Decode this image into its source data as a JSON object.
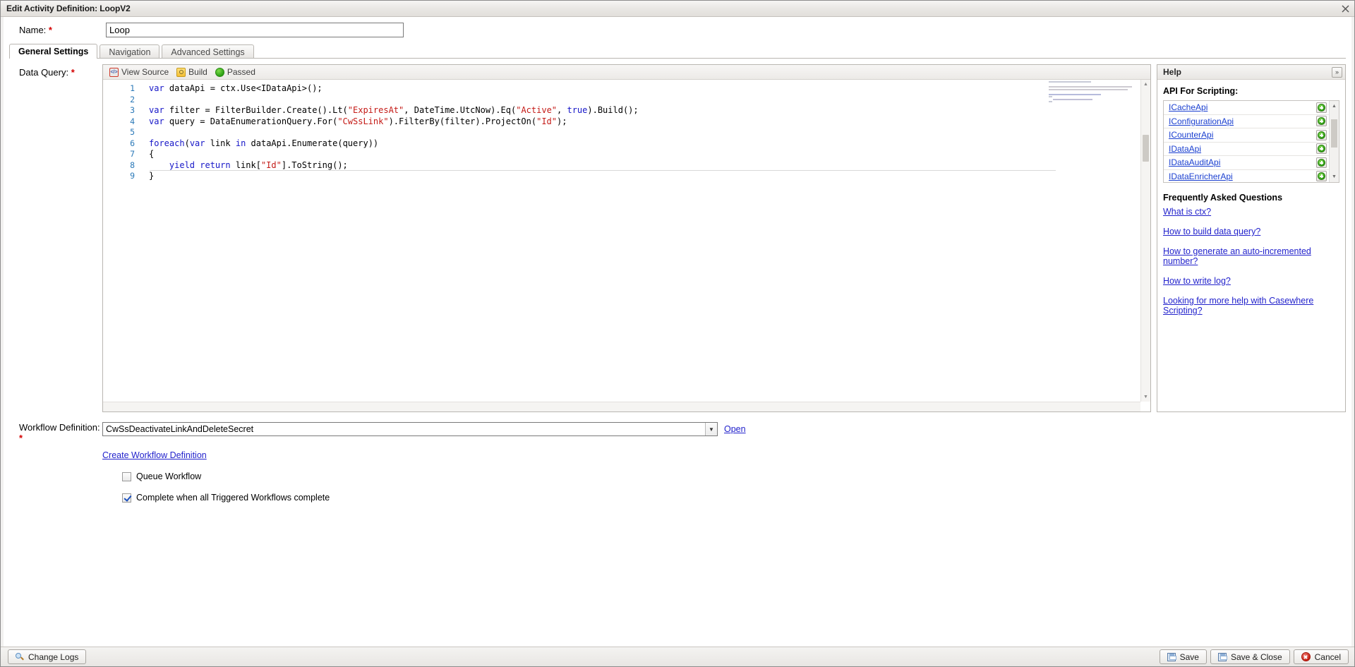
{
  "window": {
    "title": "Edit Activity Definition: LoopV2",
    "close_icon": "close-icon"
  },
  "form": {
    "name_label": "Name:",
    "name_value": "Loop",
    "required_marker": "*",
    "data_query_label": "Data Query:",
    "workflow_label": "Workflow Definition:"
  },
  "tabs": [
    {
      "label": "General Settings",
      "active": true
    },
    {
      "label": "Navigation",
      "active": false
    },
    {
      "label": "Advanced Settings",
      "active": false
    }
  ],
  "editor": {
    "toolbar": {
      "view_source": "View Source",
      "build": "Build",
      "status": "Passed",
      "status_color": "#2da015"
    },
    "lines": [
      {
        "n": "1",
        "segments": [
          {
            "t": "var ",
            "c": "kw"
          },
          {
            "t": "dataApi = ctx.Use<IDataApi>();",
            "c": "code-txt"
          }
        ]
      },
      {
        "n": "2",
        "segments": []
      },
      {
        "n": "3",
        "segments": [
          {
            "t": "var ",
            "c": "kw"
          },
          {
            "t": "filter = FilterBuilder.Create().Lt(",
            "c": "code-txt"
          },
          {
            "t": "\"ExpiresAt\"",
            "c": "str"
          },
          {
            "t": ", DateTime.UtcNow).Eq(",
            "c": "code-txt"
          },
          {
            "t": "\"Active\"",
            "c": "str"
          },
          {
            "t": ", ",
            "c": "code-txt"
          },
          {
            "t": "true",
            "c": "kw"
          },
          {
            "t": ").Build();",
            "c": "code-txt"
          }
        ]
      },
      {
        "n": "4",
        "segments": [
          {
            "t": "var ",
            "c": "kw"
          },
          {
            "t": "query = DataEnumerationQuery.For(",
            "c": "code-txt"
          },
          {
            "t": "\"CwSsLink\"",
            "c": "str"
          },
          {
            "t": ").FilterBy(filter).ProjectOn(",
            "c": "code-txt"
          },
          {
            "t": "\"Id\"",
            "c": "str"
          },
          {
            "t": ");",
            "c": "code-txt"
          }
        ]
      },
      {
        "n": "5",
        "segments": []
      },
      {
        "n": "6",
        "segments": [
          {
            "t": "foreach",
            "c": "cf"
          },
          {
            "t": "(",
            "c": "code-txt"
          },
          {
            "t": "var ",
            "c": "kw"
          },
          {
            "t": "link ",
            "c": "code-txt"
          },
          {
            "t": "in ",
            "c": "kw"
          },
          {
            "t": "dataApi.Enumerate(query))",
            "c": "code-txt"
          }
        ]
      },
      {
        "n": "7",
        "segments": [
          {
            "t": "{",
            "c": "code-txt"
          }
        ]
      },
      {
        "n": "8",
        "segments": [
          {
            "t": "    ",
            "c": "code-txt"
          },
          {
            "t": "yield return ",
            "c": "kw"
          },
          {
            "t": "link[",
            "c": "code-txt"
          },
          {
            "t": "\"Id\"",
            "c": "str"
          },
          {
            "t": "].ToString();",
            "c": "code-txt"
          }
        ]
      },
      {
        "n": "9",
        "segments": [
          {
            "t": "}",
            "c": "code-txt"
          }
        ]
      }
    ]
  },
  "help": {
    "header": "Help",
    "collapse_icon": "chevron-double-right-icon",
    "api_heading": "API For Scripting:",
    "api_items": [
      "ICacheApi",
      "IConfigurationApi",
      "ICounterApi",
      "IDataApi",
      "IDataAuditApi",
      "IDataEnricherApi"
    ],
    "faq_heading": "Frequently Asked Questions",
    "faq_links": [
      "What is ctx?",
      "How to build data query?",
      "How to generate an auto-incremented number?",
      "How to write log?",
      "Looking for more help with Casewhere Scripting?"
    ]
  },
  "workflow": {
    "selected": "CwSsDeactivateLinkAndDeleteSecret",
    "open_link": "Open",
    "create_link": "Create Workflow Definition",
    "checkboxes": [
      {
        "label": "Queue Workflow",
        "checked": false
      },
      {
        "label": "Complete when all Triggered Workflows complete",
        "checked": true
      }
    ]
  },
  "footer": {
    "change_logs": "Change Logs",
    "save": "Save",
    "save_close": "Save & Close",
    "cancel": "Cancel"
  }
}
